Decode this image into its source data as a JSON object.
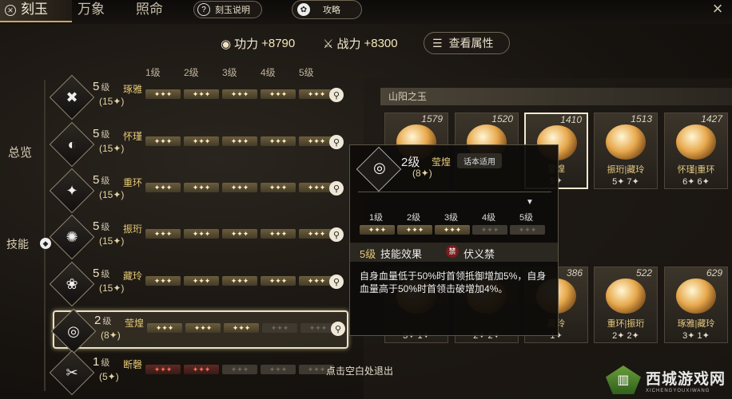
{
  "nav": {
    "tabs": [
      "刻玉",
      "万象",
      "照命"
    ],
    "help_label": "刻玉说明",
    "guide_label": "攻略",
    "close": "×"
  },
  "stats": {
    "gongli_label": "功力",
    "gongli_value": "+8790",
    "zhanli_label": "战力",
    "zhanli_value": "+8300",
    "attr_button": "查看属性"
  },
  "sidebar": {
    "overview": "总览",
    "skill": "技能"
  },
  "levels": [
    "1级",
    "2级",
    "3级",
    "4级",
    "5级"
  ],
  "rows": [
    {
      "level": "5",
      "suffix": "级",
      "name": "琢雅",
      "count": "(15✦)",
      "filled": 5,
      "color": "gold"
    },
    {
      "level": "5",
      "suffix": "级",
      "name": "怀瑾",
      "count": "(15✦)",
      "filled": 5,
      "color": "gold"
    },
    {
      "level": "5",
      "suffix": "级",
      "name": "重环",
      "count": "(15✦)",
      "filled": 5,
      "color": "gold"
    },
    {
      "level": "5",
      "suffix": "级",
      "name": "振珩",
      "count": "(15✦)",
      "filled": 5,
      "color": "gold"
    },
    {
      "level": "5",
      "suffix": "级",
      "name": "藏玲",
      "count": "(15✦)",
      "filled": 5,
      "color": "gold"
    },
    {
      "level": "2",
      "suffix": "级",
      "name": "莹煌",
      "count": "(8✦)",
      "filled": 2.6,
      "color": "gold"
    },
    {
      "level": "1",
      "suffix": "级",
      "name": "断磬",
      "count": "(5✦)",
      "filled": 1.6,
      "color": "red"
    }
  ],
  "section_title": "山阳之玉",
  "cards_top": [
    {
      "num": "1579",
      "name": "",
      "count": ""
    },
    {
      "num": "1520",
      "name": "",
      "count": ""
    },
    {
      "num": "1410",
      "name": "莹煌",
      "count": "5✦"
    },
    {
      "num": "1513",
      "name": "振珩|藏玲",
      "count": "5✦  7✦"
    },
    {
      "num": "1427",
      "name": "怀瑾|重环",
      "count": "6✦  6✦"
    }
  ],
  "cards_bottom": [
    {
      "num": "",
      "name": "",
      "count": "3✦  1✦"
    },
    {
      "num": "",
      "name": "",
      "count": "2✦  2✦"
    },
    {
      "num": "386",
      "name": "藏玲",
      "count": "1✦"
    },
    {
      "num": "522",
      "name": "重环|振珩",
      "count": "2✦  2✦"
    },
    {
      "num": "629",
      "name": "琢雅|藏玲",
      "count": "3✦  1✦"
    }
  ],
  "popup": {
    "level": "2级",
    "name": "莹煌",
    "tag": "话本适用",
    "count": "(8✦)",
    "levels": [
      "1级",
      "2级",
      "3级",
      "4级",
      "5级"
    ],
    "effect_level": "5级",
    "effect_label": "技能效果",
    "ban_icon": "禁",
    "ban_label": "伏义禁",
    "desc": "自身血量低于50%时首领抵御增加5%，自身血量高于50%时首领击破增加4%。"
  },
  "hint": "点击空白处退出",
  "watermark": {
    "text": "西城游戏网",
    "sub": "XICHENGYOUXIWANG"
  }
}
